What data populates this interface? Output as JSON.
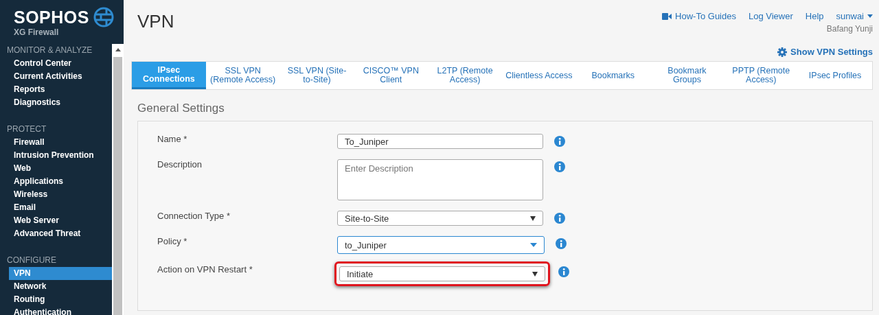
{
  "brand": {
    "name": "SOPHOS",
    "product": "XG Firewall"
  },
  "sidebar": {
    "sections": [
      {
        "title": "MONITOR & ANALYZE",
        "items": [
          {
            "label": "Control Center",
            "selected": false
          },
          {
            "label": "Current Activities",
            "selected": false
          },
          {
            "label": "Reports",
            "selected": false
          },
          {
            "label": "Diagnostics",
            "selected": false
          }
        ]
      },
      {
        "title": "PROTECT",
        "items": [
          {
            "label": "Firewall",
            "selected": false
          },
          {
            "label": "Intrusion Prevention",
            "selected": false
          },
          {
            "label": "Web",
            "selected": false
          },
          {
            "label": "Applications",
            "selected": false
          },
          {
            "label": "Wireless",
            "selected": false
          },
          {
            "label": "Email",
            "selected": false
          },
          {
            "label": "Web Server",
            "selected": false
          },
          {
            "label": "Advanced Threat",
            "selected": false
          }
        ]
      },
      {
        "title": "CONFIGURE",
        "items": [
          {
            "label": "VPN",
            "selected": true
          },
          {
            "label": "Network",
            "selected": false
          },
          {
            "label": "Routing",
            "selected": false
          },
          {
            "label": "Authentication",
            "selected": false
          }
        ]
      }
    ]
  },
  "page": {
    "title": "VPN"
  },
  "top_links": [
    {
      "label": "How-To Guides",
      "kind": "video"
    },
    {
      "label": "Log Viewer",
      "kind": "plain"
    },
    {
      "label": "Help",
      "kind": "plain"
    },
    {
      "label": "sunwai",
      "kind": "menu"
    }
  ],
  "organization": "Bafang Yunji",
  "settings_link": "Show VPN Settings",
  "tabs": [
    {
      "label": "IPsec Connections",
      "selected": true
    },
    {
      "label": "SSL VPN (Remote Access)",
      "selected": false
    },
    {
      "label": "SSL VPN (Site-to-Site)",
      "selected": false
    },
    {
      "label": "CISCO™ VPN Client",
      "selected": false
    },
    {
      "label": "L2TP (Remote Access)",
      "selected": false
    },
    {
      "label": "Clientless Access",
      "selected": false
    },
    {
      "label": "Bookmarks",
      "selected": false
    },
    {
      "label": "Bookmark Groups",
      "selected": false
    },
    {
      "label": "PPTP (Remote Access)",
      "selected": false
    },
    {
      "label": "IPsec Profiles",
      "selected": false
    }
  ],
  "section_title": "General Settings",
  "fields": [
    {
      "label": "Name *",
      "kind": "text",
      "value": "To_Juniper",
      "focused": false,
      "highlighted": false
    },
    {
      "label": "Description",
      "kind": "textarea",
      "placeholder": "Enter Description",
      "focused": false,
      "highlighted": false
    },
    {
      "label": "Connection Type *",
      "kind": "select",
      "value": "Site-to-Site",
      "focused": false,
      "highlighted": false
    },
    {
      "label": "Policy *",
      "kind": "select",
      "value": "to_Juniper",
      "focused": true,
      "highlighted": false
    },
    {
      "label": "Action on VPN Restart *",
      "kind": "select",
      "value": "Initiate",
      "focused": false,
      "highlighted": true
    }
  ]
}
